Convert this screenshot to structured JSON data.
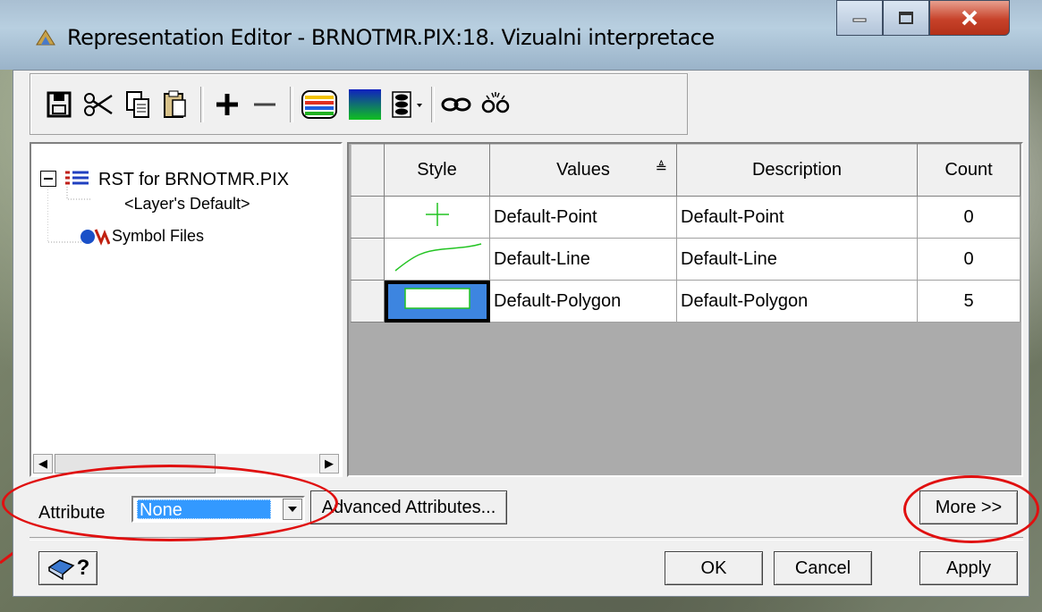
{
  "window": {
    "title": "Representation Editor - BRNOTMR.PIX:18. Vizualni interpretace",
    "buttons": [
      "minimize",
      "maximize",
      "close"
    ]
  },
  "toolbar": {
    "icons": [
      "save-icon",
      "cut-icon",
      "copy-icon",
      "paste-icon",
      "add-icon",
      "remove-icon",
      "color-palette-icon",
      "gradient-icon",
      "style-dropdown-icon",
      "link-icon",
      "unlink-icon"
    ]
  },
  "tree": {
    "root_label": "RST for BRNOTMR.PIX",
    "child_label": "<Layer's Default>",
    "symbol_files_label": "Symbol Files"
  },
  "table": {
    "columns": [
      "Style",
      "Values",
      "Description",
      "Count"
    ],
    "sort_indicator": "≜",
    "rows": [
      {
        "style": "point",
        "values": "Default-Point",
        "description": "Default-Point",
        "count": "0"
      },
      {
        "style": "line",
        "values": "Default-Line",
        "description": "Default-Line",
        "count": "0"
      },
      {
        "style": "polygon",
        "values": "Default-Polygon",
        "description": "Default-Polygon",
        "count": "5"
      }
    ]
  },
  "attribute": {
    "label": "Attribute",
    "value": "None"
  },
  "buttons": {
    "advanced": "Advanced Attributes...",
    "more": "More >>",
    "ok": "OK",
    "cancel": "Cancel",
    "apply": "Apply",
    "help": "?"
  },
  "colors": {
    "accent_red": "#e01010",
    "selection": "#3399ff",
    "symbol_green": "#22c422"
  }
}
